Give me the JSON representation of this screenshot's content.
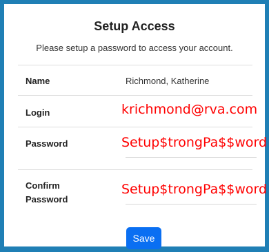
{
  "form": {
    "title": "Setup Access",
    "subtitle": "Please setup a password to access your account.",
    "name_label": "Name",
    "name_value": "Richmond, Katherine",
    "login_label": "Login",
    "login_value": "krichmond@rva.com",
    "password_label": "Password",
    "password_value": "Setup$trongPa$$word",
    "confirm_label_line1": "Confirm",
    "confirm_label_line2": "Password",
    "confirm_value": "Setup$trongPa$$word",
    "save_label": "Save"
  },
  "colors": {
    "frame_border": "#1f7fb5",
    "annotation_red": "#ff0000",
    "save_button": "#0a6ff2"
  }
}
